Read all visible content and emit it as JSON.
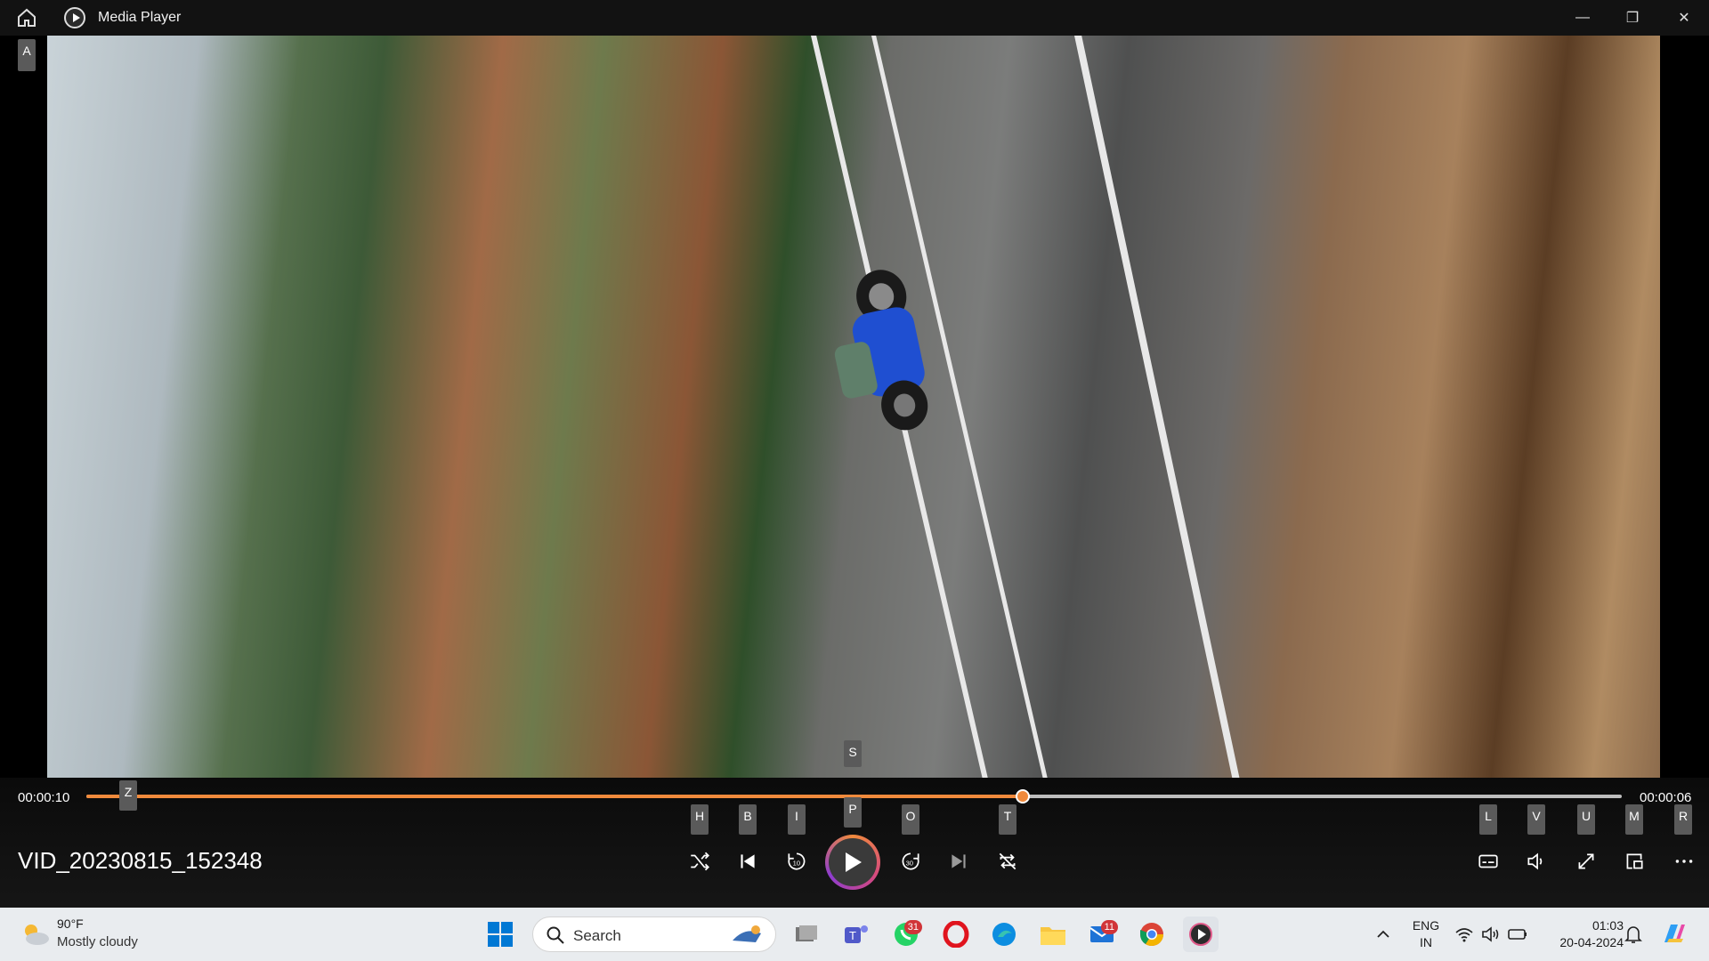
{
  "window": {
    "title": "Media Player",
    "controls": {
      "minimize": "—",
      "restore": "❐",
      "close": "✕"
    }
  },
  "video": {
    "file_title": "VID_20230815_152348"
  },
  "playback": {
    "elapsed": "00:00:10",
    "remaining": "00:00:06",
    "progress_fraction": 0.61
  },
  "keytips": {
    "home": "A",
    "seek": "Z",
    "play_above": "S",
    "shuffle": "H",
    "previous": "B",
    "rewind": "I",
    "play": "P",
    "forward": "O",
    "repeat": "T",
    "subtitles": "L",
    "volume": "V",
    "fullscreen": "U",
    "miniplayer": "M",
    "more": "R"
  },
  "icons": {
    "home": "home-icon",
    "shuffle": "shuffle-icon",
    "previous": "previous-icon",
    "rewind": "rewind-10-icon",
    "play": "play-icon",
    "forward": "forward-30-icon",
    "next": "next-icon",
    "repeat": "repeat-icon",
    "subtitles": "subtitles-icon",
    "volume": "volume-icon",
    "fullscreen": "fullscreen-icon",
    "miniplayer": "miniplayer-icon",
    "more": "more-icon"
  },
  "accent_color": "#f08a3c",
  "taskbar": {
    "weather": {
      "temp": "90°F",
      "desc": "Mostly cloudy"
    },
    "search_label": "Search",
    "badges": {
      "whatsapp": "31",
      "mail": "11"
    },
    "lang": {
      "line1": "ENG",
      "line2": "IN"
    },
    "clock": {
      "time": "01:03",
      "date": "20-04-2024"
    }
  }
}
